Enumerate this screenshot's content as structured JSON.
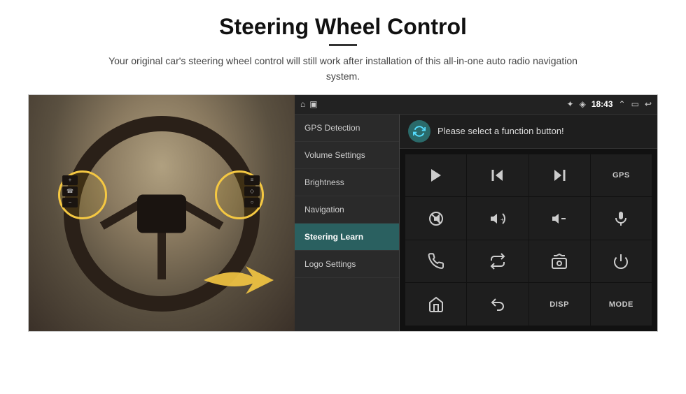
{
  "page": {
    "title": "Steering Wheel Control",
    "divider": true,
    "subtitle": "Your original car's steering wheel control will still work after installation of this all-in-one auto radio navigation system."
  },
  "status_bar": {
    "time": "18:43",
    "icons_left": [
      "home-icon",
      "photo-icon"
    ],
    "icons_right": [
      "bluetooth-icon",
      "wifi-icon",
      "battery-icon",
      "expand-icon",
      "back-icon"
    ]
  },
  "menu": {
    "items": [
      {
        "label": "GPS Detection",
        "active": false
      },
      {
        "label": "Volume Settings",
        "active": false
      },
      {
        "label": "Brightness",
        "active": false
      },
      {
        "label": "Navigation",
        "active": false
      },
      {
        "label": "Steering Learn",
        "active": true
      },
      {
        "label": "Logo Settings",
        "active": false
      }
    ]
  },
  "panel": {
    "header_text": "Please select a function button!",
    "refresh_label": "refresh"
  },
  "function_buttons": [
    {
      "type": "icon",
      "name": "play-btn",
      "icon": "play"
    },
    {
      "type": "icon",
      "name": "prev-btn",
      "icon": "skip-back"
    },
    {
      "type": "icon",
      "name": "next-btn",
      "icon": "skip-forward"
    },
    {
      "type": "text",
      "name": "gps-btn",
      "label": "GPS"
    },
    {
      "type": "icon",
      "name": "mute-btn",
      "icon": "mute"
    },
    {
      "type": "icon",
      "name": "vol-up-btn",
      "icon": "vol-up"
    },
    {
      "type": "icon",
      "name": "vol-down-btn",
      "icon": "vol-down"
    },
    {
      "type": "icon",
      "name": "mic-btn",
      "icon": "mic"
    },
    {
      "type": "icon",
      "name": "phone-btn",
      "icon": "phone"
    },
    {
      "type": "icon",
      "name": "loop-btn",
      "icon": "loop"
    },
    {
      "type": "icon",
      "name": "radio-btn",
      "icon": "radio"
    },
    {
      "type": "icon",
      "name": "power-btn",
      "icon": "power"
    },
    {
      "type": "icon",
      "name": "home-btn",
      "icon": "home"
    },
    {
      "type": "icon",
      "name": "back-btn",
      "icon": "back-arrow"
    },
    {
      "type": "text",
      "name": "disp-btn",
      "label": "DISP"
    },
    {
      "type": "text",
      "name": "mode-btn",
      "label": "MODE"
    }
  ]
}
